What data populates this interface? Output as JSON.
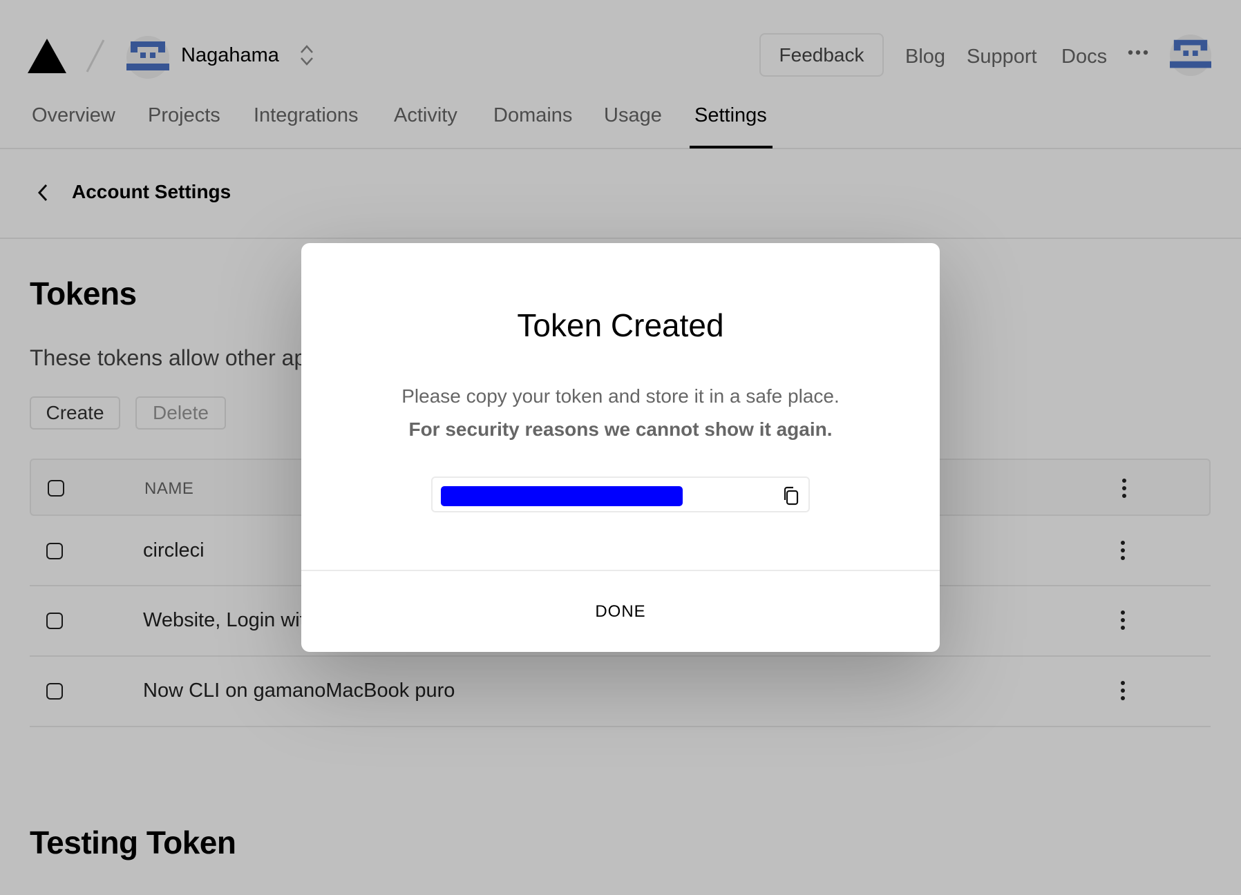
{
  "header": {
    "team_name": "Nagahama",
    "feedback_label": "Feedback",
    "links": [
      "Blog",
      "Support",
      "Docs"
    ]
  },
  "tabs": [
    "Overview",
    "Projects",
    "Integrations",
    "Activity",
    "Domains",
    "Usage",
    "Settings"
  ],
  "active_tab": "Settings",
  "subheader": {
    "title": "Account Settings"
  },
  "tokens": {
    "heading": "Tokens",
    "description": "These tokens allow other ap",
    "create_label": "Create",
    "delete_label": "Delete",
    "column_name": "NAME",
    "rows": [
      "circleci",
      "Website, Login wit",
      "Now CLI on gamanoMacBook puro"
    ]
  },
  "testing_token": {
    "heading": "Testing Token"
  },
  "modal": {
    "title": "Token Created",
    "line1": "Please copy your token and store it in a safe place.",
    "line2": "For security reasons we cannot show it again.",
    "token_redaction_color": "#0000ff",
    "done_label": "DONE"
  },
  "colors": {
    "accent": "#000000",
    "border": "#eaeaea",
    "avatar_blue": "#4a72c4"
  },
  "icons": [
    "triangle-logo-icon",
    "chevron-up-down-icon",
    "more-horizontal-icon",
    "chevron-left-icon",
    "more-vertical-icon",
    "copy-icon"
  ]
}
